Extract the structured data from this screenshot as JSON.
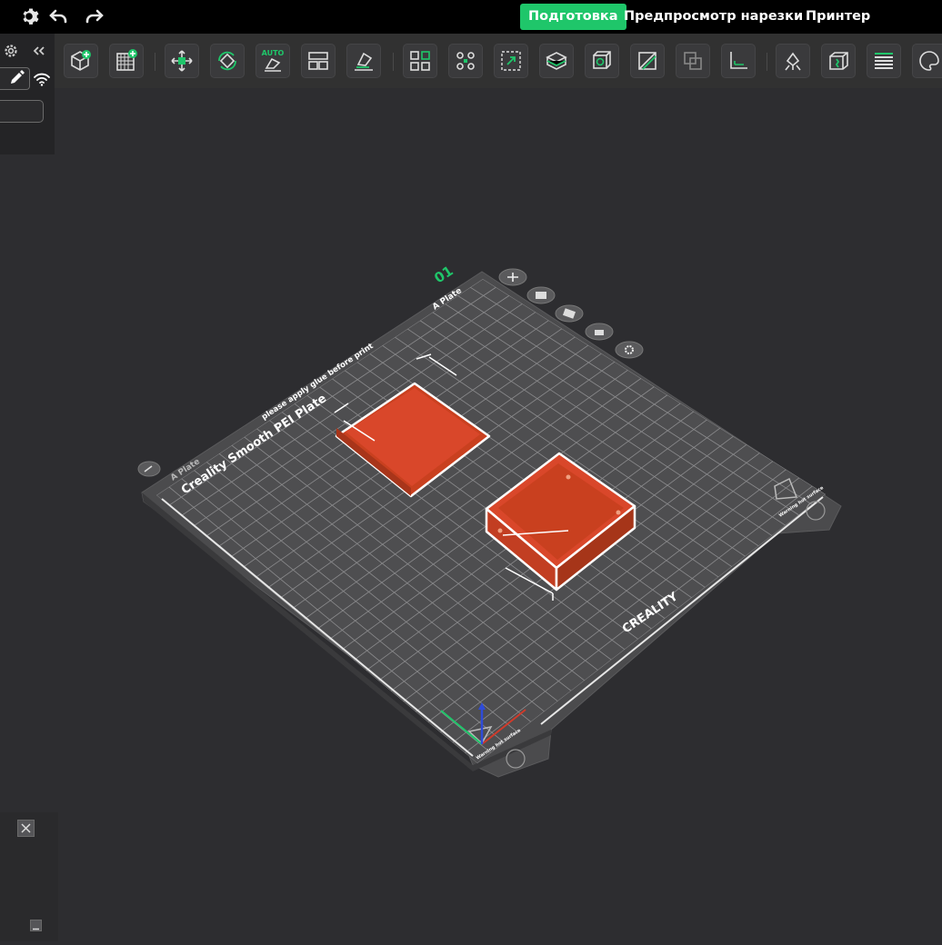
{
  "titlebar": {
    "tabs": [
      {
        "label": "Подготовка",
        "active": true
      },
      {
        "label": "Предпросмотр нарезки",
        "active": false
      },
      {
        "label": "Принтер",
        "active": false
      }
    ],
    "icons": [
      "settings-gear-icon",
      "undo-icon",
      "redo-icon"
    ]
  },
  "toolbar": {
    "auto_badge": "AUTO",
    "buttons": [
      "add-object-icon",
      "add-plate-icon",
      "auto-orient-icon",
      "rotate-icon",
      "auto-arrange-icon",
      "layout-icon",
      "lay-on-face-icon",
      "split-objects-icon",
      "split-parts-icon",
      "fit-view-icon",
      "cut-icon",
      "boolean-icon",
      "slice-plane-icon",
      "merge-icon",
      "measure-icon",
      "support-paint-icon",
      "seam-paint-icon",
      "variable-layer-icon",
      "color-paint-icon"
    ]
  },
  "left_panel": {
    "icons": [
      "settings-icon",
      "collapse-icon",
      "edit-pencil-icon",
      "wifi-icon"
    ]
  },
  "plate": {
    "number": "01",
    "name_left": "A Plate",
    "name_top": "A Plate",
    "title": "Creality Smooth PEI Plate",
    "note": "please apply glue before print",
    "brand": "CREALITY",
    "warning_right": "Warning hot surface",
    "warning_bottom": "Warning hot surface",
    "side_icons": [
      "plate-add-icon",
      "plate-arrange-icon",
      "plate-orient-icon",
      "plate-lock-icon",
      "plate-settings-icon"
    ]
  },
  "colors": {
    "accent": "#1fc66a",
    "model": "#d9472a",
    "bed": "#4a4a4c",
    "grid": "#8a8a8a",
    "background": "#2d2d30"
  },
  "bottom_panel": {
    "icons": [
      "close-icon",
      "minimize-icon"
    ]
  }
}
